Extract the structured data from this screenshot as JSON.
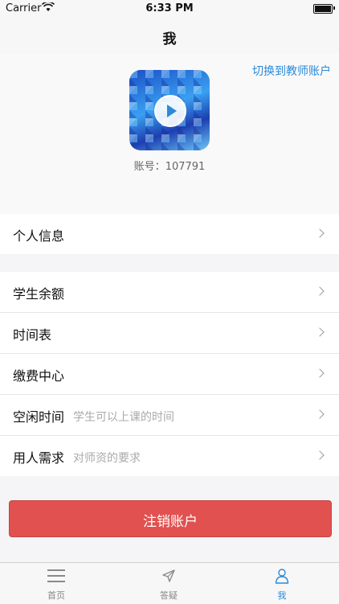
{
  "status": {
    "carrier": "Carrier",
    "time": "6:33 PM"
  },
  "nav": {
    "title": "我"
  },
  "profile": {
    "switch_link": "切换到教师账户",
    "account_label": "账号：",
    "account_id": "107791",
    "avatar_icon": "play-icon"
  },
  "menu": {
    "group1": [
      {
        "label": "个人信息"
      }
    ],
    "group2": [
      {
        "label": "学生余额"
      },
      {
        "label": "时间表"
      },
      {
        "label": "缴费中心"
      },
      {
        "label": "空闲时间",
        "hint": "学生可以上课的时间"
      },
      {
        "label": "用人需求",
        "hint": "对师资的要求"
      }
    ]
  },
  "logout_label": "注销账户",
  "tabs": [
    {
      "label": "首页",
      "icon": "menu-lines-icon"
    },
    {
      "label": "答疑",
      "icon": "send-icon"
    },
    {
      "label": "我",
      "icon": "person-icon"
    }
  ],
  "colors": {
    "accent": "#2a8ad8",
    "danger": "#e0514f"
  }
}
